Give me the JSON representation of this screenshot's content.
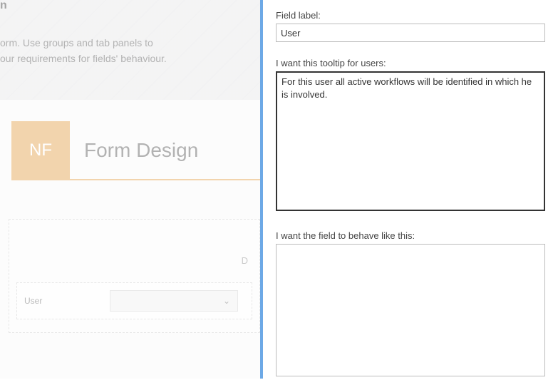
{
  "left": {
    "hero_truncated_top": "n",
    "hero_line1": "orm. Use groups and tab panels to",
    "hero_line2": "our requirements for fields' behaviour.",
    "badge": "NF",
    "title": "Form Design",
    "placeholder_letter": "D",
    "field_label": "User"
  },
  "props": {
    "field_label_caption": "Field label:",
    "field_label_value": "User",
    "tooltip_caption": "I want this tooltip for users:",
    "tooltip_value": "For this user all active workflows will be identified in which he is involved.",
    "behave_caption": "I want the field to behave like this:",
    "behave_value": ""
  }
}
